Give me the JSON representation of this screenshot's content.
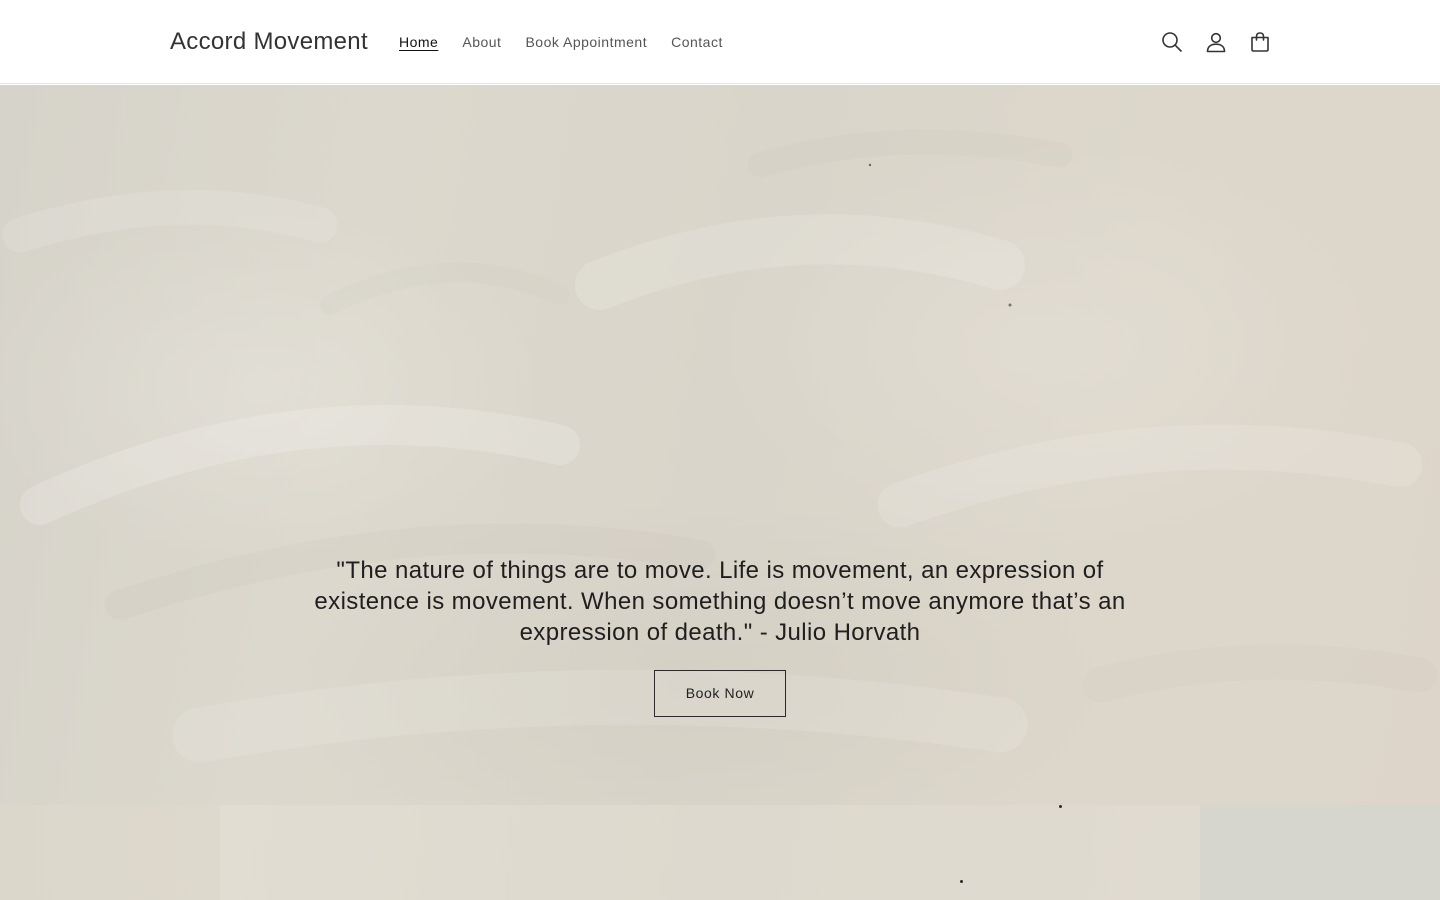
{
  "header": {
    "brand": "Accord Movement",
    "nav": [
      {
        "label": "Home",
        "active": true
      },
      {
        "label": "About",
        "active": false
      },
      {
        "label": "Book Appointment",
        "active": false
      },
      {
        "label": "Contact",
        "active": false
      }
    ],
    "icons": [
      "search-icon",
      "account-icon",
      "cart-icon"
    ]
  },
  "hero": {
    "quote": "\"The nature of things are to move. Life is movement, an expression of existence is movement. When something doesn’t move anymore that’s an expression of death.\" - Julio Horvath",
    "button_label": "Book Now"
  },
  "colors": {
    "hero_background": "#d9d5ca",
    "text": "#121212",
    "nav_text": "#555555",
    "lower_right_panel": "#d6d6ce"
  }
}
